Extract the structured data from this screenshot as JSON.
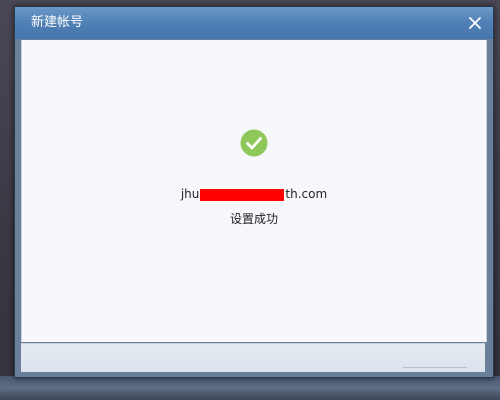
{
  "dialog": {
    "title": "新建帐号",
    "close_icon": "close-icon",
    "success_icon": "check-circle-icon",
    "success_color": "#8fc85a",
    "email_prefix": "jhu",
    "email_suffix": "th.com",
    "status_text": "设置成功"
  }
}
